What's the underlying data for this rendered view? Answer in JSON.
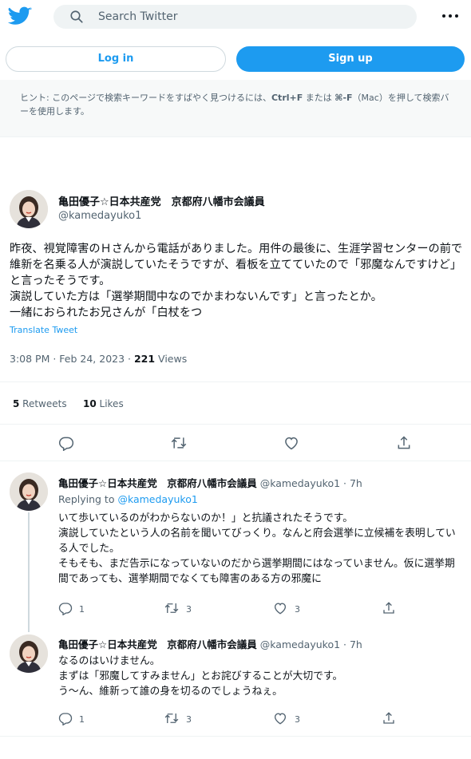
{
  "header": {
    "search_placeholder": "Search Twitter",
    "login_label": "Log in",
    "signup_label": "Sign up"
  },
  "hint": {
    "text_prefix": "ヒント: このページで検索キーワードをすばやく見つけるには、",
    "shortcut_win": "Ctrl+F",
    "text_mid": " または ",
    "shortcut_mac": "⌘-F",
    "text_suffix": "（Mac）を押して検索バーを使用します。"
  },
  "tweet": {
    "name": "亀田優子☆日本共産党　京都府八幡市会議員",
    "handle": "@kamedayuko1",
    "body": "昨夜、視覚障害のＨさんから電話がありました。用件の最後に、生涯学習センターの前で維新を名乗る人が演説していたそうですが、看板を立てていたので「邪魔なんですけど」と言ったそうです。\n演説していた方は「選挙期間中なのでかまわないんです」と言ったとか。\n一緒におられたお兄さんが「白杖をつ",
    "translate_label": "Translate Tweet",
    "time": "3:08 PM · Feb 24, 2023 · ",
    "views_count": "221",
    "views_label": " Views",
    "retweets_count": "5",
    "retweets_label": " Retweets",
    "likes_count": "10",
    "likes_label": " Likes"
  },
  "replies": [
    {
      "name": "亀田優子☆日本共産党　京都府八幡市会議員",
      "handle": "@kamedayuko1 · 7h",
      "replying_label": "Replying to ",
      "replying_to": "@kamedayuko1",
      "body": "いて歩いているのがわからないのか！」と抗議されたそうです。\n演説していたという人の名前を聞いてびっくり。なんと府会選挙に立候補を表明している人でした。\nそもそも、まだ告示になっていないのだから選挙期間にはなっていません。仮に選挙期間であっても、選挙期間でなくても障害のある方の邪魔に",
      "replies": "1",
      "retweets": "3",
      "likes": "3"
    },
    {
      "name": "亀田優子☆日本共産党　京都府八幡市会議員",
      "handle": "@kamedayuko1 · 7h",
      "body": "なるのはいけません。\nまずは「邪魔してすみません」とお詫びすることが大切です。\nう～ん、維新って誰の身を切るのでしょうねぇ。",
      "replies": "1",
      "retweets": "3",
      "likes": "3"
    }
  ],
  "colors": {
    "accent": "#1d9bf0",
    "text": "#0f1419",
    "muted": "#536471",
    "border": "#eff3f4"
  },
  "icons": [
    "twitter-bird-icon",
    "search-icon",
    "more-icon",
    "reply-icon",
    "retweet-icon",
    "like-icon",
    "share-icon"
  ]
}
